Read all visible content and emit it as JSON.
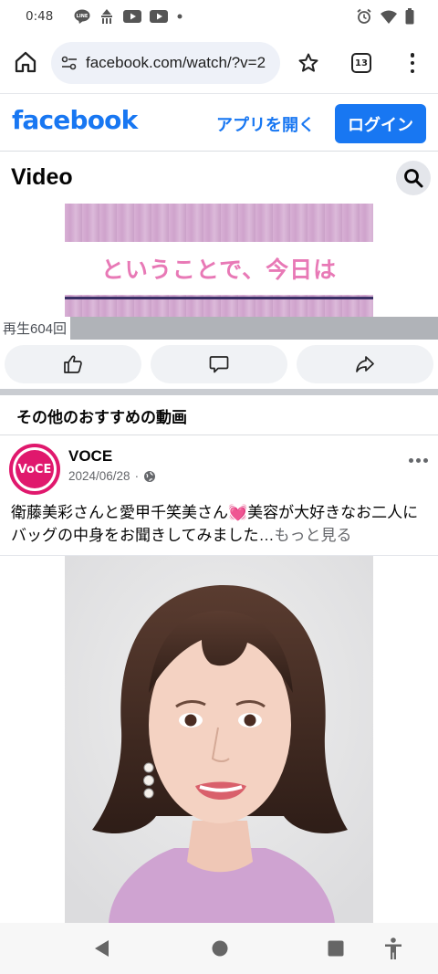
{
  "status_bar": {
    "time": "0:48",
    "left_icons": [
      "line-icon",
      "app-icon",
      "youtube-icon",
      "youtube-icon",
      "dot-icon"
    ],
    "right_icons": [
      "alarm-icon",
      "wifi-icon",
      "battery-icon"
    ]
  },
  "browser": {
    "url": "facebook.com/watch/?v=2",
    "tab_count": "13"
  },
  "fb_header": {
    "logo": "facebook",
    "open_app": "アプリを開く",
    "login": "ログイン",
    "brand_color": "#1877f2"
  },
  "video_section": {
    "title": "Video",
    "video_caption": "ということで、今日は",
    "views": "再生604回"
  },
  "recommendations": {
    "heading": "その他のおすすめの動画",
    "post": {
      "avatar_text": "VoCE",
      "page_name": "VOCE",
      "date": "2024/06/28",
      "separator": "·",
      "text": "衛藤美彩さんと愛甲千笑美さん",
      "emoji": "💓",
      "text_after": "美容が大好きなお二人にバッグの中身をお聞きしてみました…",
      "see_more": "もっと見る"
    }
  },
  "colors": {
    "accent_pink": "#e0186d",
    "caption_pink": "#e879b6"
  }
}
